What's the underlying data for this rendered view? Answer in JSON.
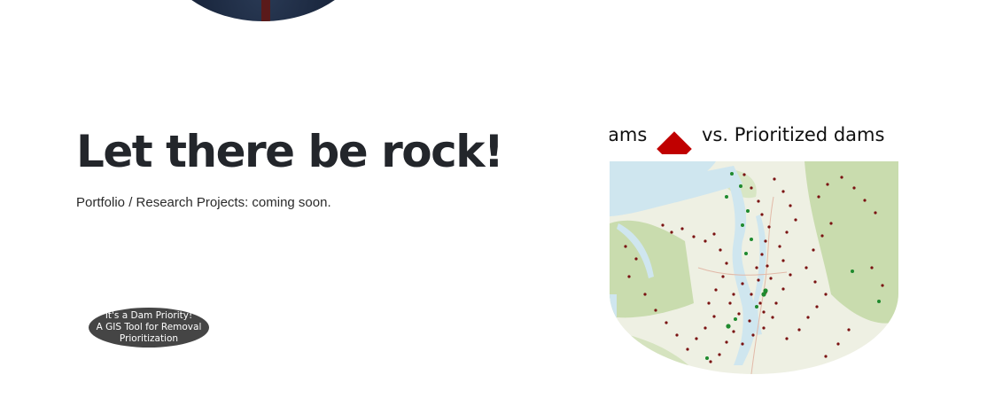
{
  "headline": "Let there be rock!",
  "subtitle": "Portfolio / Research Projects: coming soon.",
  "badge": {
    "lines": [
      "It's a Dam Priority!",
      "A GIS Tool for Removal",
      "Prioritization"
    ]
  },
  "map_image": {
    "title_left": "ams",
    "title_right": "vs. Prioritized dams",
    "colors": {
      "water": "#cfe6ef",
      "land": "#eef0e3",
      "forest": "#c9dcae",
      "dam": "#7a1212",
      "prioritized_dam": "#1f8a2e",
      "diamond": "#c00000"
    }
  },
  "avatar": {
    "icon": "profile-photo"
  }
}
